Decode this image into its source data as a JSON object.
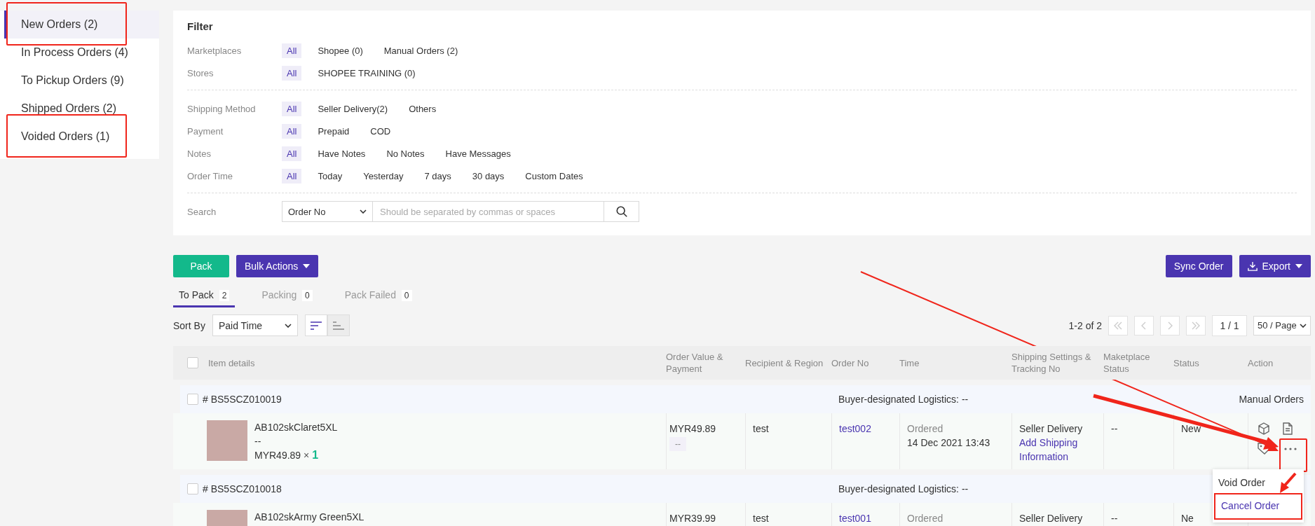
{
  "sidebar": {
    "items": [
      {
        "label": "New Orders (2)",
        "selected": true,
        "annotated": true
      },
      {
        "label": "In Process Orders (4)",
        "selected": false,
        "annotated": false
      },
      {
        "label": "To Pickup Orders (9)",
        "selected": false,
        "annotated": false
      },
      {
        "label": "Shipped Orders (2)",
        "selected": false,
        "annotated": false
      },
      {
        "label": "Voided Orders (1)",
        "selected": false,
        "annotated": true
      }
    ]
  },
  "filter": {
    "title": "Filter",
    "sections": [
      [
        {
          "label": "Marketplaces",
          "options": [
            {
              "label": "All",
              "selected": true
            },
            {
              "label": "Shopee (0)",
              "selected": false
            },
            {
              "label": "Manual Orders (2)",
              "selected": false
            }
          ]
        },
        {
          "label": "Stores",
          "options": [
            {
              "label": "All",
              "selected": true
            },
            {
              "label": "SHOPEE TRAINING (0)",
              "selected": false
            }
          ]
        }
      ],
      [
        {
          "label": "Shipping Method",
          "options": [
            {
              "label": "All",
              "selected": true
            },
            {
              "label": "Seller Delivery(2)",
              "selected": false
            },
            {
              "label": "Others",
              "selected": false
            }
          ]
        },
        {
          "label": "Payment",
          "options": [
            {
              "label": "All",
              "selected": true
            },
            {
              "label": "Prepaid",
              "selected": false
            },
            {
              "label": "COD",
              "selected": false
            }
          ]
        },
        {
          "label": "Notes",
          "options": [
            {
              "label": "All",
              "selected": true
            },
            {
              "label": "Have Notes",
              "selected": false
            },
            {
              "label": "No Notes",
              "selected": false
            },
            {
              "label": "Have Messages",
              "selected": false
            }
          ]
        },
        {
          "label": "Order Time",
          "options": [
            {
              "label": "All",
              "selected": true
            },
            {
              "label": "Today",
              "selected": false
            },
            {
              "label": "Yesterday",
              "selected": false
            },
            {
              "label": "7 days",
              "selected": false
            },
            {
              "label": "30 days",
              "selected": false
            },
            {
              "label": "Custom Dates",
              "selected": false
            }
          ]
        }
      ]
    ],
    "search": {
      "label": "Search",
      "type": "Order No",
      "placeholder": "Should be separated by commas or spaces"
    }
  },
  "toolbar": {
    "pack": "Pack",
    "bulk_actions": "Bulk Actions",
    "sync": "Sync Order",
    "export": "Export"
  },
  "tabs": [
    {
      "label": "To Pack",
      "count": "2",
      "selected": true
    },
    {
      "label": "Packing",
      "count": "0",
      "selected": false
    },
    {
      "label": "Pack Failed",
      "count": "0",
      "selected": false
    }
  ],
  "sort": {
    "label": "Sort By",
    "value": "Paid Time",
    "order_buttons": [
      {
        "selected": true
      },
      {
        "selected": false
      }
    ]
  },
  "pagination": {
    "range": "1-2 of 2",
    "page": "1 / 1",
    "page_size": "50 / Page"
  },
  "table": {
    "select_all": {
      "checked": false
    },
    "columns": [
      "Item details",
      "Order Value & Payment",
      "Recipient & Region",
      "Order No",
      "Time",
      "Shipping Settings & Tracking No",
      "Maketplace Status",
      "Status",
      "Action"
    ],
    "orders": [
      {
        "number": "# BS5SCZ010019",
        "checked": false,
        "logistics": "Buyer-designated Logistics: --",
        "source": "Manual Orders",
        "item": {
          "sku": "AB102skClaret5XL",
          "variant": "--",
          "price": "MYR49.89",
          "qty_sign": "×",
          "qty": "1"
        },
        "value": "MYR49.89",
        "payment": "--",
        "recipient": "test",
        "order_no": "test002",
        "time_status": "Ordered",
        "time": "14 Dec 2021 13:43",
        "shipping": "Seller Delivery",
        "shipping_link": "Add Shipping Information",
        "marketplace_status": "--",
        "status": "New",
        "menu": [
          {
            "label": "Void Order",
            "hovered": false,
            "annotated": false
          },
          {
            "label": "Cancel Order",
            "hovered": true,
            "annotated": true
          }
        ]
      },
      {
        "number": "# BS5SCZ010018",
        "checked": false,
        "logistics": "Buyer-designated Logistics: --",
        "item": {
          "sku": "AB102skArmy Green5XL"
        },
        "value": "MYR39.99",
        "recipient": "test",
        "order_no": "test001",
        "time_status": "Ordered",
        "shipping": "Seller Delivery",
        "marketplace_status": "--",
        "status": "Ne"
      }
    ]
  }
}
